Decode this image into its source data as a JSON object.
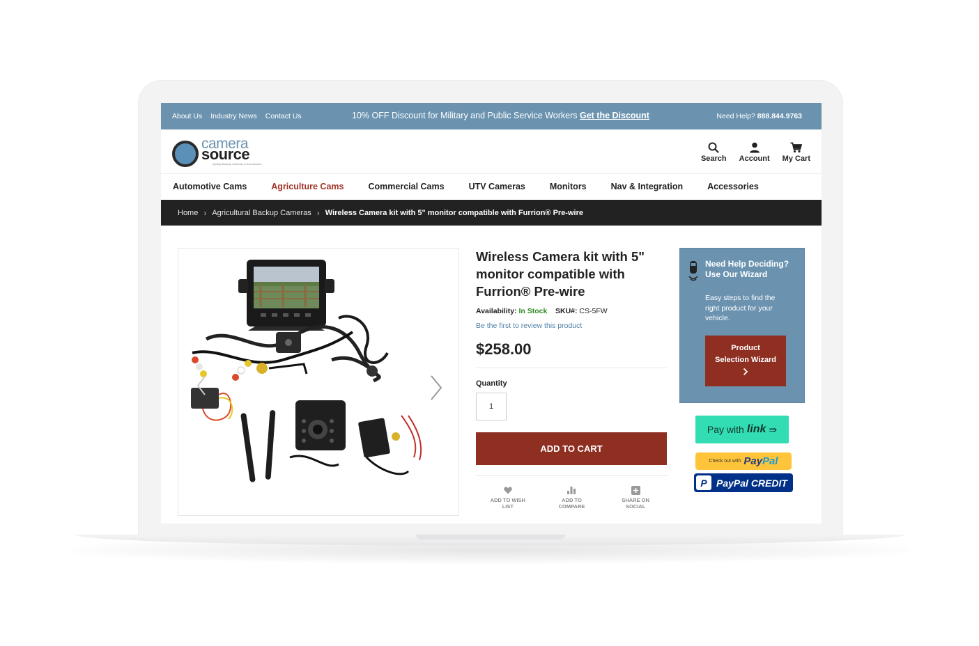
{
  "topbar": {
    "links": [
      "About Us",
      "Industry News",
      "Contact Us"
    ],
    "promo_text": "10% OFF Discount for Military and Public Service Workers",
    "promo_link": "Get the Discount",
    "help_label": "Need Help?",
    "help_phone": "888.844.9763"
  },
  "logo": {
    "line1": "camera",
    "line2": "source",
    "tagline": "Quality Backup Cameras & Accessories"
  },
  "header_icons": {
    "search": "Search",
    "account": "Account",
    "cart": "My Cart"
  },
  "nav": {
    "items": [
      "Automotive Cams",
      "Agriculture Cams",
      "Commercial Cams",
      "UTV Cameras",
      "Monitors",
      "Nav & Integration",
      "Accessories"
    ],
    "active": "Agriculture Cams"
  },
  "breadcrumb": {
    "home": "Home",
    "category": "Agricultural Backup Cameras",
    "current": "Wireless Camera kit with 5\" monitor compatible with Furrion® Pre-wire"
  },
  "product": {
    "title": "Wireless Camera kit with 5\" monitor compatible with Furrion® Pre-wire",
    "availability_label": "Availability:",
    "availability_value": "In Stock",
    "sku_label": "SKU#:",
    "sku_value": "CS-5FW",
    "review_link": "Be the first to review this product",
    "price": "$258.00",
    "quantity_label": "Quantity",
    "quantity_value": "1",
    "add_to_cart": "ADD TO CART",
    "actions": {
      "wishlist": "ADD TO WISH LIST",
      "compare": "ADD TO COMPARE",
      "share": "SHARE ON SOCIAL"
    }
  },
  "wizard": {
    "title": "Need Help Deciding? Use Our Wizard",
    "description": "Easy steps to find the right product for your vehicle.",
    "button": "Product Selection Wizard"
  },
  "payments": {
    "link_prefix": "Pay with",
    "link_brand": "link",
    "paypal_checkout": "Check out with",
    "paypal_brand_1": "Pay",
    "paypal_brand_2": "Pal",
    "paypal_credit": "PayPal CREDIT"
  },
  "colors": {
    "topbar": "#6b93b0",
    "accent_red": "#8e2f22",
    "nav_active": "#a33326",
    "in_stock": "#2e8b20",
    "link_green": "#33ddb3",
    "paypal_yellow": "#ffc439",
    "paypal_navy": "#003087"
  }
}
